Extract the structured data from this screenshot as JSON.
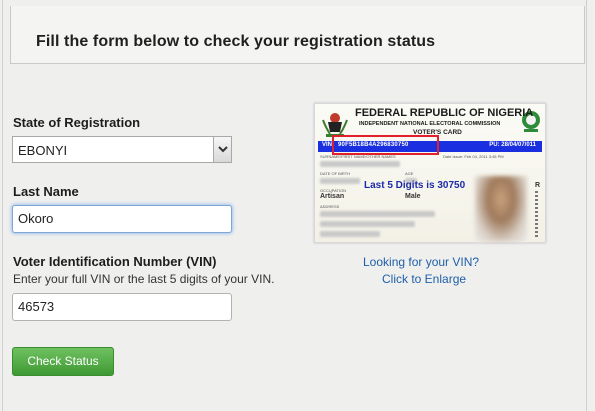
{
  "header": {
    "title": "Fill the form below to check your registration status"
  },
  "form": {
    "state_label": "State of Registration",
    "state_value": "EBONYI",
    "lastname_label": "Last Name",
    "lastname_value": "Okoro",
    "vin_label": "Voter Identification Number (VIN)",
    "vin_hint": "Enter your full VIN or the last 5 digits of your VIN.",
    "vin_value": "46573",
    "submit_label": "Check Status"
  },
  "card": {
    "title": "FEDERAL REPUBLIC OF NIGERIA",
    "subtitle": "INDEPENDENT NATIONAL ELECTORAL COMMISSION",
    "card_name": "VOTER'S CARD",
    "vin_label": "VIN",
    "vin_number": "90F5B18B4A296830750",
    "pu": "PU: 28/04/07/011",
    "surname_label": "SURNAME/FIRST NAME/OTHER NAMES",
    "dob_label": "DATE OF BIRTH",
    "age_label": "AGE",
    "occupation_label": "OCCUPATION",
    "occupation_value": "Artisan",
    "gender_value": "Male",
    "address_label": "ADDRESS",
    "date_label": "Date Issue: Feb 04, 2011 3:45 PM",
    "side_letter": "R",
    "annotation": "Last 5 Digits is 30750"
  },
  "links": {
    "looking": "Looking for your VIN?",
    "enlarge": "Click to Enlarge"
  },
  "colors": {
    "button_green": "#4aa63f",
    "link_blue": "#1f5fa8",
    "card_band": "#1a2fe0",
    "highlight_red": "#e0202a"
  }
}
